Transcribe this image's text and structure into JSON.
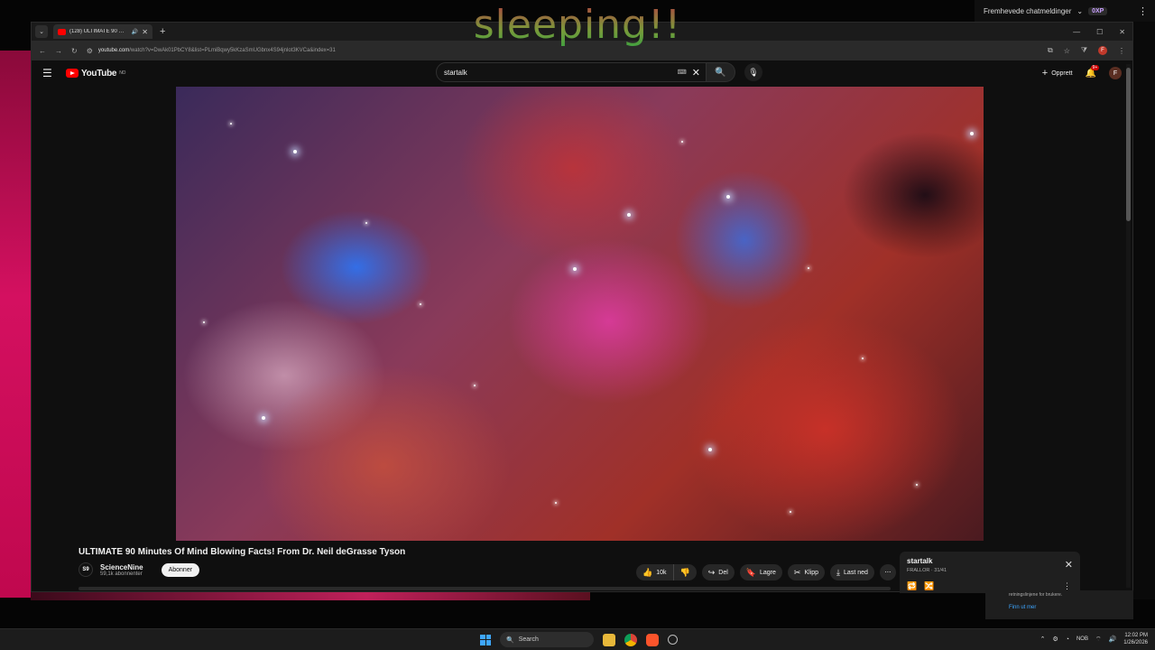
{
  "overlay": {
    "title": "sleeping!!"
  },
  "chat": {
    "label": "Fremhevede chatmeldinger",
    "badge": "0XP"
  },
  "browser": {
    "tab_title": "(128) ULTIMATE 90 Minutes Of Mind Blowing Facts!",
    "url_host": "youtube.com",
    "url_rest": "/watch?v=DwAk01PbCY8&list=PLmiBqwy5kKzaSmUGbnx4S94jnlot3KVCa&index=31",
    "profile_letter": "F"
  },
  "youtube": {
    "logo_text": "YouTube",
    "logo_region": "NO",
    "search_value": "startalk",
    "create_label": "Opprett",
    "notification_count": "9+",
    "avatar_letter": "F"
  },
  "video": {
    "title": "ULTIMATE 90 Minutes Of Mind Blowing Facts! From Dr. Neil deGrasse Tyson",
    "channel_name": "ScienceNine",
    "channel_initials": "S9",
    "subscribers": "59,1k abonnenter",
    "subscribe_label": "Abonner",
    "like_count": "10k",
    "share_label": "Del",
    "save_label": "Lagre",
    "clip_label": "Klipp",
    "download_label": "Last ned"
  },
  "playlist": {
    "title": "startalk",
    "owner_position": "FRALLOR · 31/41"
  },
  "notification": {
    "text": "retningslinjene for brukere.",
    "link": "Finn ut mer"
  },
  "taskbar": {
    "search_placeholder": "Search",
    "language": "NOB",
    "time": "12:02 PM",
    "date": "1/26/2026"
  }
}
